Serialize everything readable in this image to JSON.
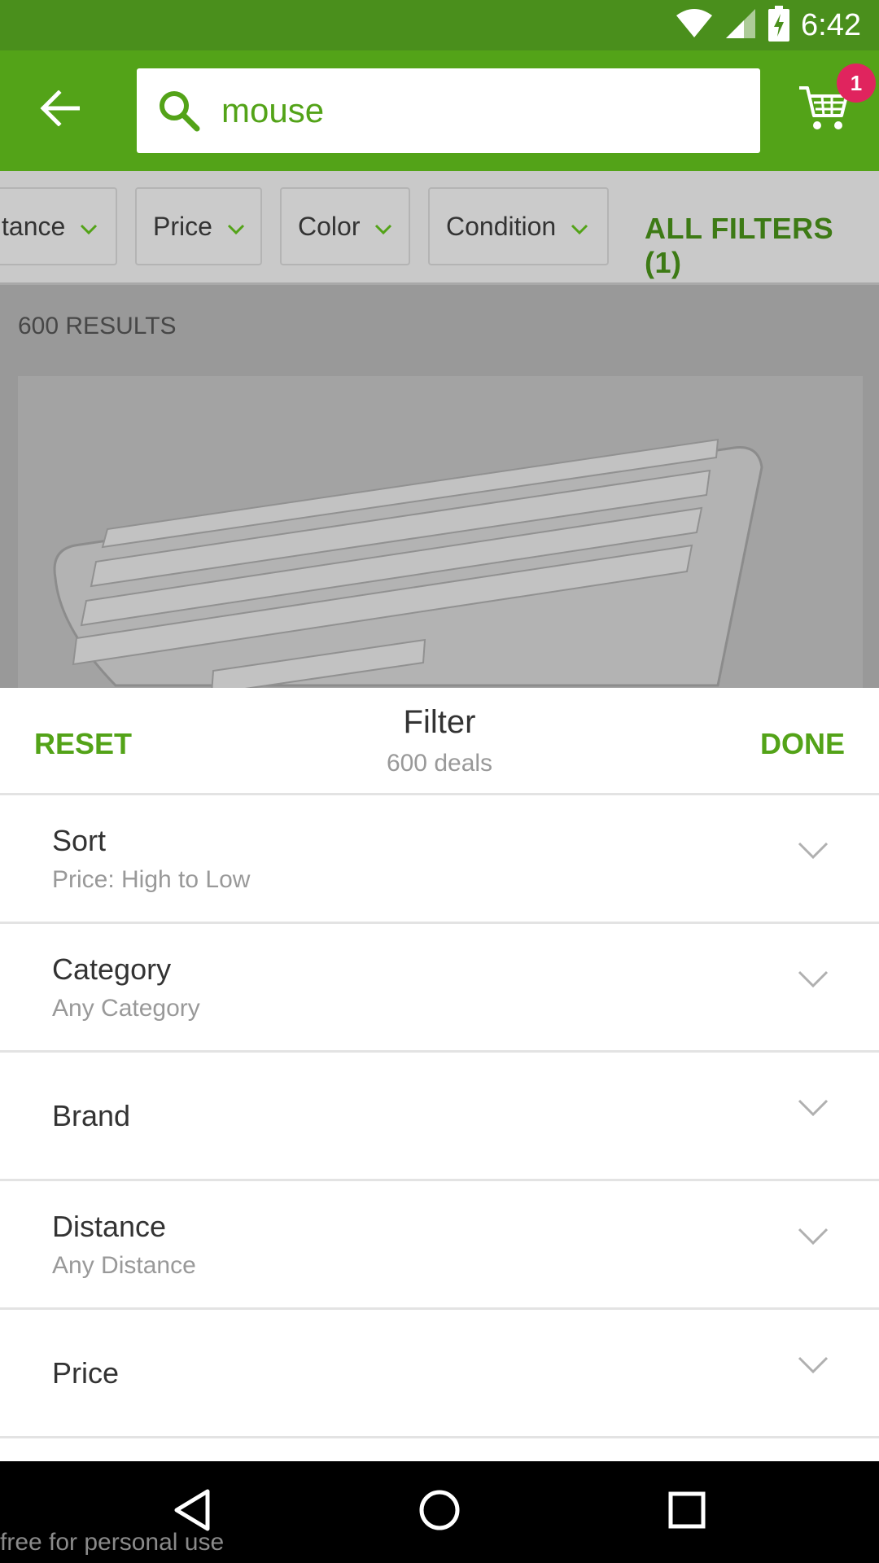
{
  "status_bar": {
    "time": "6:42",
    "icons": [
      "wifi-icon",
      "signal-icon",
      "battery-charging-icon"
    ]
  },
  "toolbar": {
    "search_value": "mouse",
    "cart_badge": "1",
    "icons": [
      "arrow-left-icon",
      "search-icon",
      "shopping-cart-icon"
    ]
  },
  "chips": {
    "distance": "tance",
    "price": "Price",
    "color": "Color",
    "condition": "Condition",
    "all_filters": "ALL FILTERS (1)"
  },
  "results": {
    "count": "600 RESULTS"
  },
  "sheet": {
    "reset": "RESET",
    "title": "Filter",
    "subtitle": "600 deals",
    "done": "DONE",
    "items": [
      {
        "label": "Sort",
        "value": "Price: High to Low"
      },
      {
        "label": "Category",
        "value": "Any Category"
      },
      {
        "label": "Brand",
        "value": ""
      },
      {
        "label": "Distance",
        "value": "Any Distance"
      },
      {
        "label": "Price",
        "value": ""
      }
    ]
  },
  "nav": {
    "icons": [
      "back-triangle-icon",
      "home-circle-icon",
      "recents-square-icon"
    ]
  },
  "watermark": "free for personal use",
  "colors": {
    "brand_green": "#53a318",
    "status_green": "#4a8f1c",
    "badge_red": "#e0245e"
  }
}
